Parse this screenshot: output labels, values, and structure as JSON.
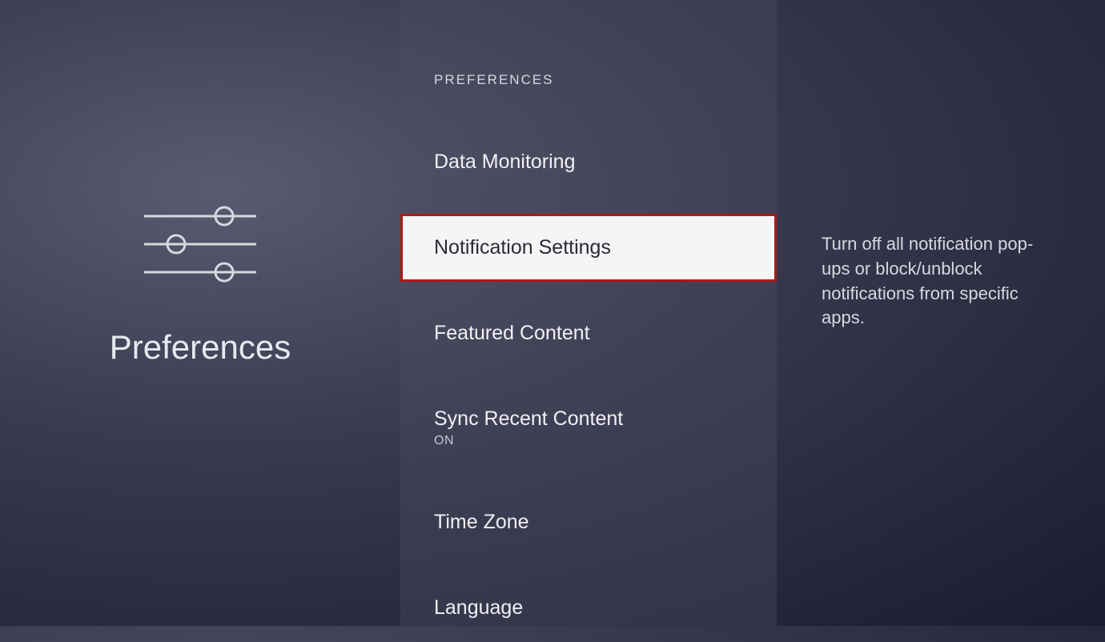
{
  "left": {
    "title": "Preferences"
  },
  "center": {
    "header": "PREFERENCES",
    "items": [
      {
        "label": "Data Monitoring",
        "sub": ""
      },
      {
        "label": "Notification Settings",
        "sub": ""
      },
      {
        "label": "Featured Content",
        "sub": ""
      },
      {
        "label": "Sync Recent Content",
        "sub": "ON"
      },
      {
        "label": "Time Zone",
        "sub": ""
      },
      {
        "label": "Language",
        "sub": ""
      }
    ]
  },
  "right": {
    "description": "Turn off all notification pop-ups or block/unblock notifications from specific apps."
  }
}
